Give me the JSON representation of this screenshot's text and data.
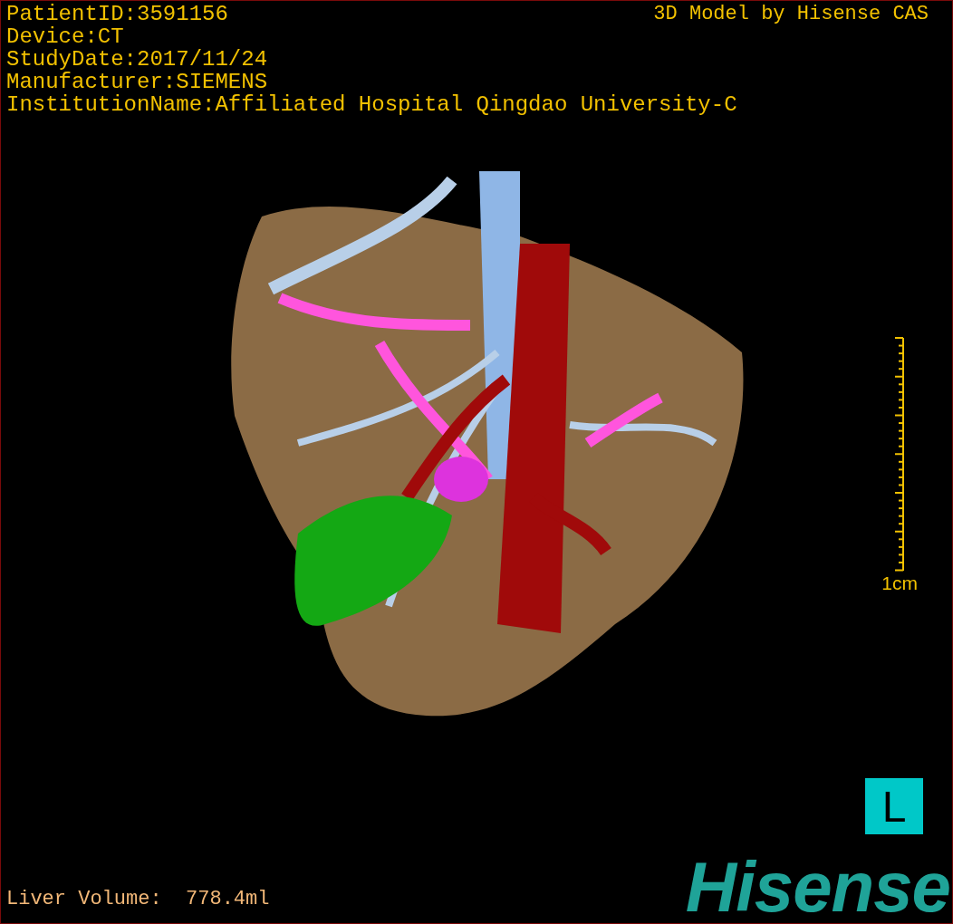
{
  "info_lines": [
    "PatientID:3591156",
    "Device:CT",
    "StudyDate:2017/11/24",
    "Manufacturer:SIEMENS",
    "InstitutionName:Affiliated Hospital Qingdao University-C"
  ],
  "title": "3D Model by Hisense CAS",
  "scale": {
    "label": "1cm"
  },
  "volume": "Liver Volume:  778.4ml",
  "orientation": "L",
  "logo": "Hisense"
}
